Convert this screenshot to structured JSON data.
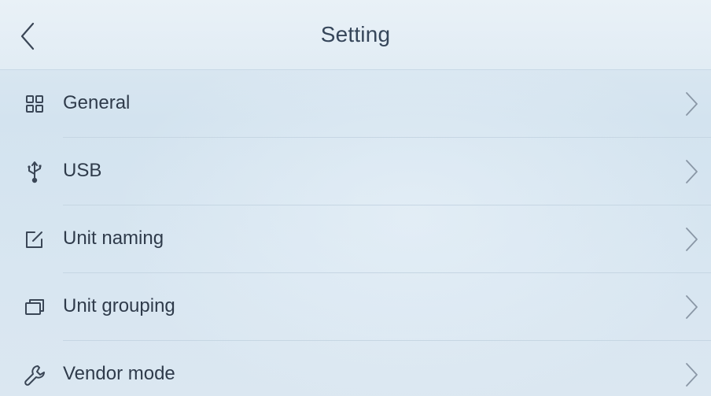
{
  "header": {
    "title": "Setting",
    "back_icon": "chevron-left-icon"
  },
  "menu": {
    "items": [
      {
        "label": "General",
        "icon": "grid-icon"
      },
      {
        "label": "USB",
        "icon": "usb-icon"
      },
      {
        "label": "Unit naming",
        "icon": "edit-icon"
      },
      {
        "label": "Unit grouping",
        "icon": "stacked-windows-icon"
      },
      {
        "label": "Vendor mode",
        "icon": "wrench-icon"
      }
    ],
    "chevron_icon": "chevron-right-icon"
  },
  "colors": {
    "text": "#2f3b4b",
    "icon_stroke": "#3a4656",
    "chevron": "#8a97a6",
    "background": "#d7e5f0"
  }
}
